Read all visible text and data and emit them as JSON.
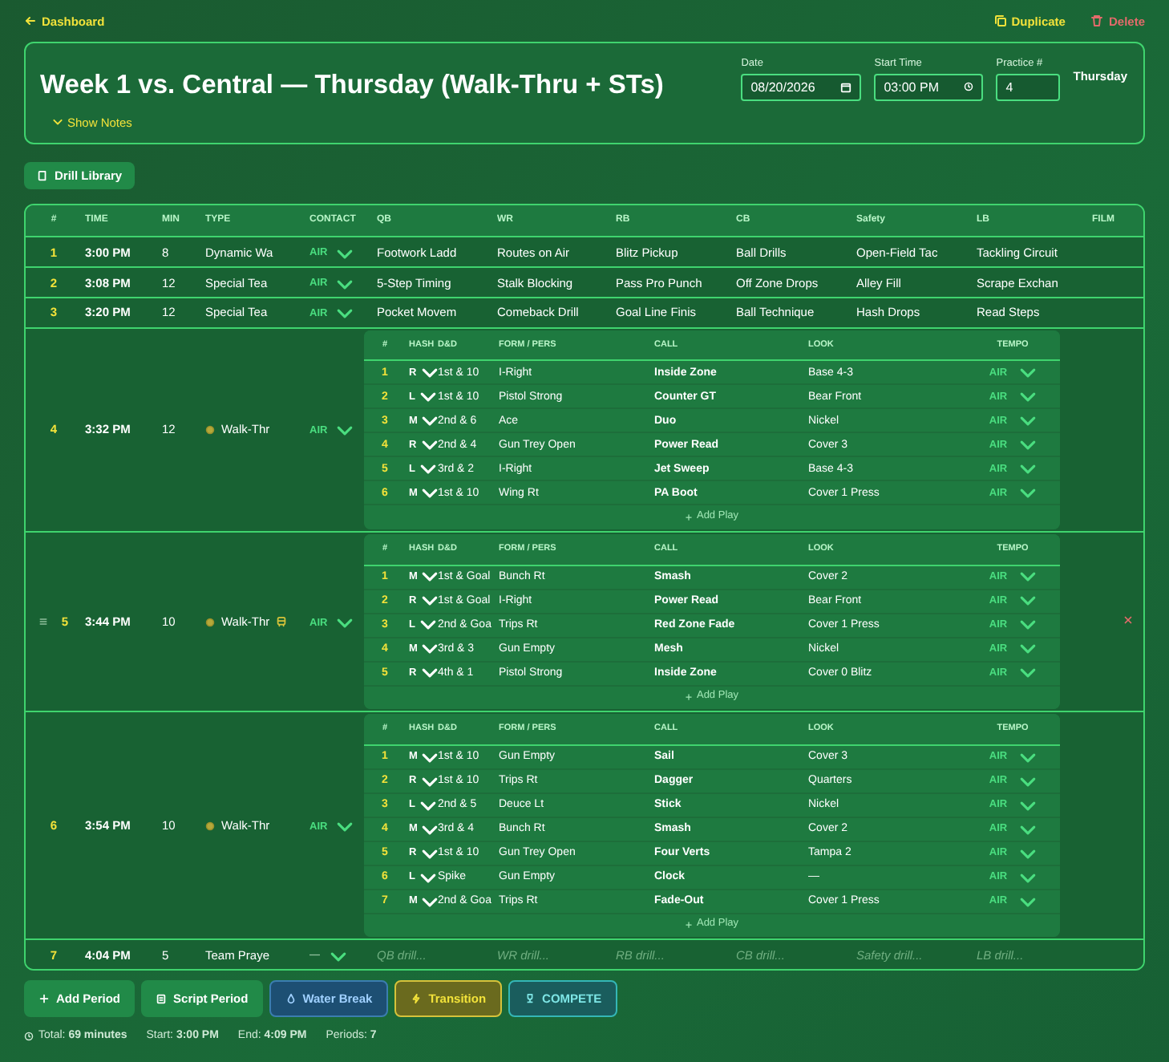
{
  "top_bar": {
    "back_link": "Dashboard",
    "actions": [
      {
        "kind": "duplicate",
        "label": "Duplicate"
      },
      {
        "kind": "delete",
        "label": "Delete"
      }
    ]
  },
  "practice": {
    "title": "Week 1 vs. Central — Thursday (Walk-Thru + STs)",
    "notes_toggle": "Show Notes",
    "fields": [
      {
        "kind": "date",
        "label": "Date",
        "value": "08/20/2026"
      },
      {
        "kind": "time",
        "label": "Start Time",
        "value": "03:00 PM"
      },
      {
        "kind": "number",
        "label": "Practice #",
        "value": "4"
      }
    ],
    "day": "Thursday"
  },
  "drill_library_button": "Drill Library",
  "schedule": {
    "columns": [
      "#",
      "TIME",
      "MIN",
      "TYPE",
      "CONTACT",
      "QB",
      "WR",
      "RB",
      "CB",
      "Safety",
      "LB",
      "FILM"
    ],
    "periods": [
      {
        "kind": "drills",
        "hovered": false,
        "number": "1",
        "time": "3:00 PM",
        "minutes": "8",
        "type": "Dynamic Wa",
        "contact": "AIR",
        "drills": [
          {
            "value": "Footwork Ladd"
          },
          {
            "value": "Routes on Air"
          },
          {
            "value": "Blitz Pickup"
          },
          {
            "value": "Ball Drills"
          },
          {
            "value": "Open-Field Tac"
          },
          {
            "value": "Tackling Circuit"
          }
        ]
      },
      {
        "kind": "drills",
        "hovered": false,
        "number": "2",
        "time": "3:08 PM",
        "minutes": "12",
        "type": "Special Tea",
        "contact": "AIR",
        "drills": [
          {
            "value": "5-Step Timing"
          },
          {
            "value": "Stalk Blocking"
          },
          {
            "value": "Pass Pro Punch"
          },
          {
            "value": "Off Zone Drops"
          },
          {
            "value": "Alley Fill"
          },
          {
            "value": "Scrape Exchan"
          }
        ]
      },
      {
        "kind": "drills",
        "hovered": false,
        "number": "3",
        "time": "3:20 PM",
        "minutes": "12",
        "type": "Special Tea",
        "contact": "AIR",
        "drills": [
          {
            "value": "Pocket Movem"
          },
          {
            "value": "Comeback Drill"
          },
          {
            "value": "Goal Line Finis"
          },
          {
            "value": "Ball Technique"
          },
          {
            "value": "Hash Drops"
          },
          {
            "value": "Read Steps"
          }
        ]
      },
      {
        "kind": "script",
        "hovered": false,
        "number": "4",
        "time": "3:32 PM",
        "minutes": "12",
        "type": "Walk-Thr",
        "contact": "AIR",
        "script": {
          "columns": [
            "#",
            "HASH",
            "D&D",
            "FORM / PERS",
            "CALL",
            "LOOK",
            "TEMPO"
          ],
          "add_play": "Add Play",
          "plays": [
            {
              "number": "1",
              "hash": "R",
              "down_distance": "1st & 10",
              "formation": "I-Right",
              "call": "Inside Zone",
              "look": "Base 4-3",
              "tempo": "AIR"
            },
            {
              "number": "2",
              "hash": "L",
              "down_distance": "1st & 10",
              "formation": "Pistol Strong",
              "call": "Counter GT",
              "look": "Bear Front",
              "tempo": "AIR"
            },
            {
              "number": "3",
              "hash": "M",
              "down_distance": "2nd & 6",
              "formation": "Ace",
              "call": "Duo",
              "look": "Nickel",
              "tempo": "AIR"
            },
            {
              "number": "4",
              "hash": "R",
              "down_distance": "2nd & 4",
              "formation": "Gun Trey Open",
              "call": "Power Read",
              "look": "Cover 3",
              "tempo": "AIR"
            },
            {
              "number": "5",
              "hash": "L",
              "down_distance": "3rd & 2",
              "formation": "I-Right",
              "call": "Jet Sweep",
              "look": "Base 4-3",
              "tempo": "AIR"
            },
            {
              "number": "6",
              "hash": "M",
              "down_distance": "1st & 10",
              "formation": "Wing Rt",
              "call": "PA Boot",
              "look": "Cover 1 Press",
              "tempo": "AIR"
            }
          ]
        }
      },
      {
        "kind": "script",
        "hovered": true,
        "number": "5",
        "time": "3:44 PM",
        "minutes": "10",
        "type": "Walk-Thr",
        "contact": "AIR",
        "script": {
          "columns": [
            "#",
            "HASH",
            "D&D",
            "FORM / PERS",
            "CALL",
            "LOOK",
            "TEMPO"
          ],
          "add_play": "Add Play",
          "plays": [
            {
              "number": "1",
              "hash": "M",
              "down_distance": "1st & Goal",
              "formation": "Bunch Rt",
              "call": "Smash",
              "look": "Cover 2",
              "tempo": "AIR"
            },
            {
              "number": "2",
              "hash": "R",
              "down_distance": "1st & Goal",
              "formation": "I-Right",
              "call": "Power Read",
              "look": "Bear Front",
              "tempo": "AIR"
            },
            {
              "number": "3",
              "hash": "L",
              "down_distance": "2nd & Goa",
              "formation": "Trips Rt",
              "call": "Red Zone Fade",
              "look": "Cover 1 Press",
              "tempo": "AIR"
            },
            {
              "number": "4",
              "hash": "M",
              "down_distance": "3rd & 3",
              "formation": "Gun Empty",
              "call": "Mesh",
              "look": "Nickel",
              "tempo": "AIR"
            },
            {
              "number": "5",
              "hash": "R",
              "down_distance": "4th & 1",
              "formation": "Pistol Strong",
              "call": "Inside Zone",
              "look": "Cover 0 Blitz",
              "tempo": "AIR"
            }
          ]
        }
      },
      {
        "kind": "script",
        "hovered": false,
        "number": "6",
        "time": "3:54 PM",
        "minutes": "10",
        "type": "Walk-Thr",
        "contact": "AIR",
        "script": {
          "columns": [
            "#",
            "HASH",
            "D&D",
            "FORM / PERS",
            "CALL",
            "LOOK",
            "TEMPO"
          ],
          "add_play": "Add Play",
          "plays": [
            {
              "number": "1",
              "hash": "M",
              "down_distance": "1st & 10",
              "formation": "Gun Empty",
              "call": "Sail",
              "look": "Cover 3",
              "tempo": "AIR"
            },
            {
              "number": "2",
              "hash": "R",
              "down_distance": "1st & 10",
              "formation": "Trips Rt",
              "call": "Dagger",
              "look": "Quarters",
              "tempo": "AIR"
            },
            {
              "number": "3",
              "hash": "L",
              "down_distance": "2nd & 5",
              "formation": "Deuce Lt",
              "call": "Stick",
              "look": "Nickel",
              "tempo": "AIR"
            },
            {
              "number": "4",
              "hash": "M",
              "down_distance": "3rd & 4",
              "formation": "Bunch Rt",
              "call": "Smash",
              "look": "Cover 2",
              "tempo": "AIR"
            },
            {
              "number": "5",
              "hash": "R",
              "down_distance": "1st & 10",
              "formation": "Gun Trey Open",
              "call": "Four Verts",
              "look": "Tampa 2",
              "tempo": "AIR"
            },
            {
              "number": "6",
              "hash": "L",
              "down_distance": "Spike",
              "formation": "Gun Empty",
              "call": "Clock",
              "look": "—",
              "tempo": "AIR"
            },
            {
              "number": "7",
              "hash": "M",
              "down_distance": "2nd & Goa",
              "formation": "Trips Rt",
              "call": "Fade-Out",
              "look": "Cover 1 Press",
              "tempo": "AIR"
            }
          ]
        }
      },
      {
        "kind": "drills",
        "hovered": false,
        "number": "7",
        "time": "4:04 PM",
        "minutes": "5",
        "type": "Team Praye",
        "contact": "—",
        "drills": [
          {
            "placeholder": "QB drill..."
          },
          {
            "placeholder": "WR drill..."
          },
          {
            "placeholder": "RB drill..."
          },
          {
            "placeholder": "CB drill..."
          },
          {
            "placeholder": "Safety drill..."
          },
          {
            "placeholder": "LB drill..."
          }
        ]
      }
    ]
  },
  "bottom_buttons": [
    {
      "kind": "add",
      "label": "Add Period"
    },
    {
      "kind": "script",
      "label": "Script Period"
    },
    {
      "kind": "water",
      "label": "Water Break"
    },
    {
      "kind": "transition",
      "label": "Transition"
    },
    {
      "kind": "compete",
      "label": "COMPETE"
    }
  ],
  "summary": [
    "Total: **69 minutes**",
    "Start: **3:00 PM**",
    "End: **4:09 PM**",
    "Periods: **7**"
  ]
}
